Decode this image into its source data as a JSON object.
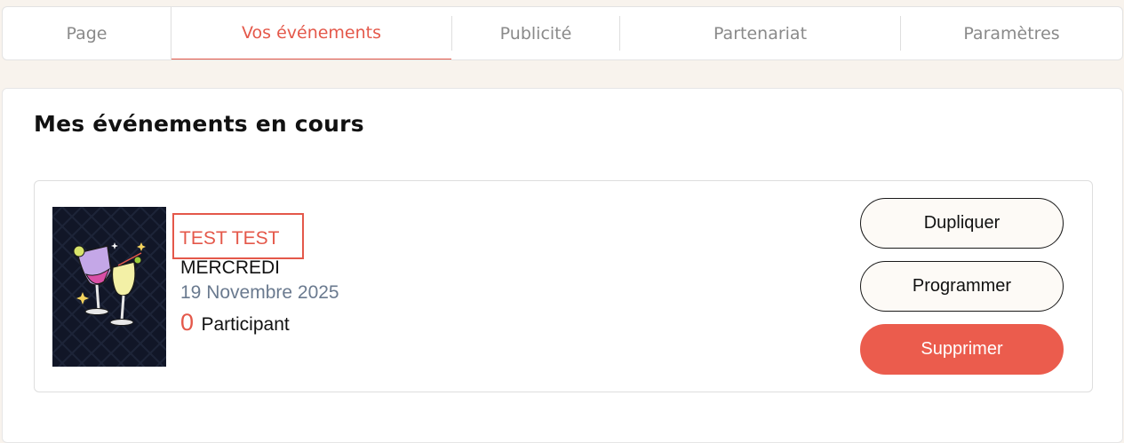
{
  "tabs": [
    {
      "label": "Page",
      "active": false
    },
    {
      "label": "Vos événements",
      "active": true
    },
    {
      "label": "Publicité",
      "active": false
    },
    {
      "label": "Partenariat",
      "active": false
    },
    {
      "label": "Paramètres",
      "active": false
    }
  ],
  "main": {
    "section_title": "Mes événements en cours",
    "event": {
      "title": "TEST TEST",
      "day": "MERCREDI",
      "date": "19 Novembre 2025",
      "participant_count": "0",
      "participant_label": "Participant",
      "thumbnail_icon": "cocktail-glasses-icon"
    },
    "actions": {
      "duplicate_label": "Dupliquer",
      "schedule_label": "Programmer",
      "delete_label": "Supprimer"
    }
  },
  "colors": {
    "accent": "#e4584a",
    "page_background": "#f8f3ed",
    "date_text": "#6a7a8f",
    "delete_button": "#eb5c4d",
    "thumbnail_background": "#111627"
  }
}
